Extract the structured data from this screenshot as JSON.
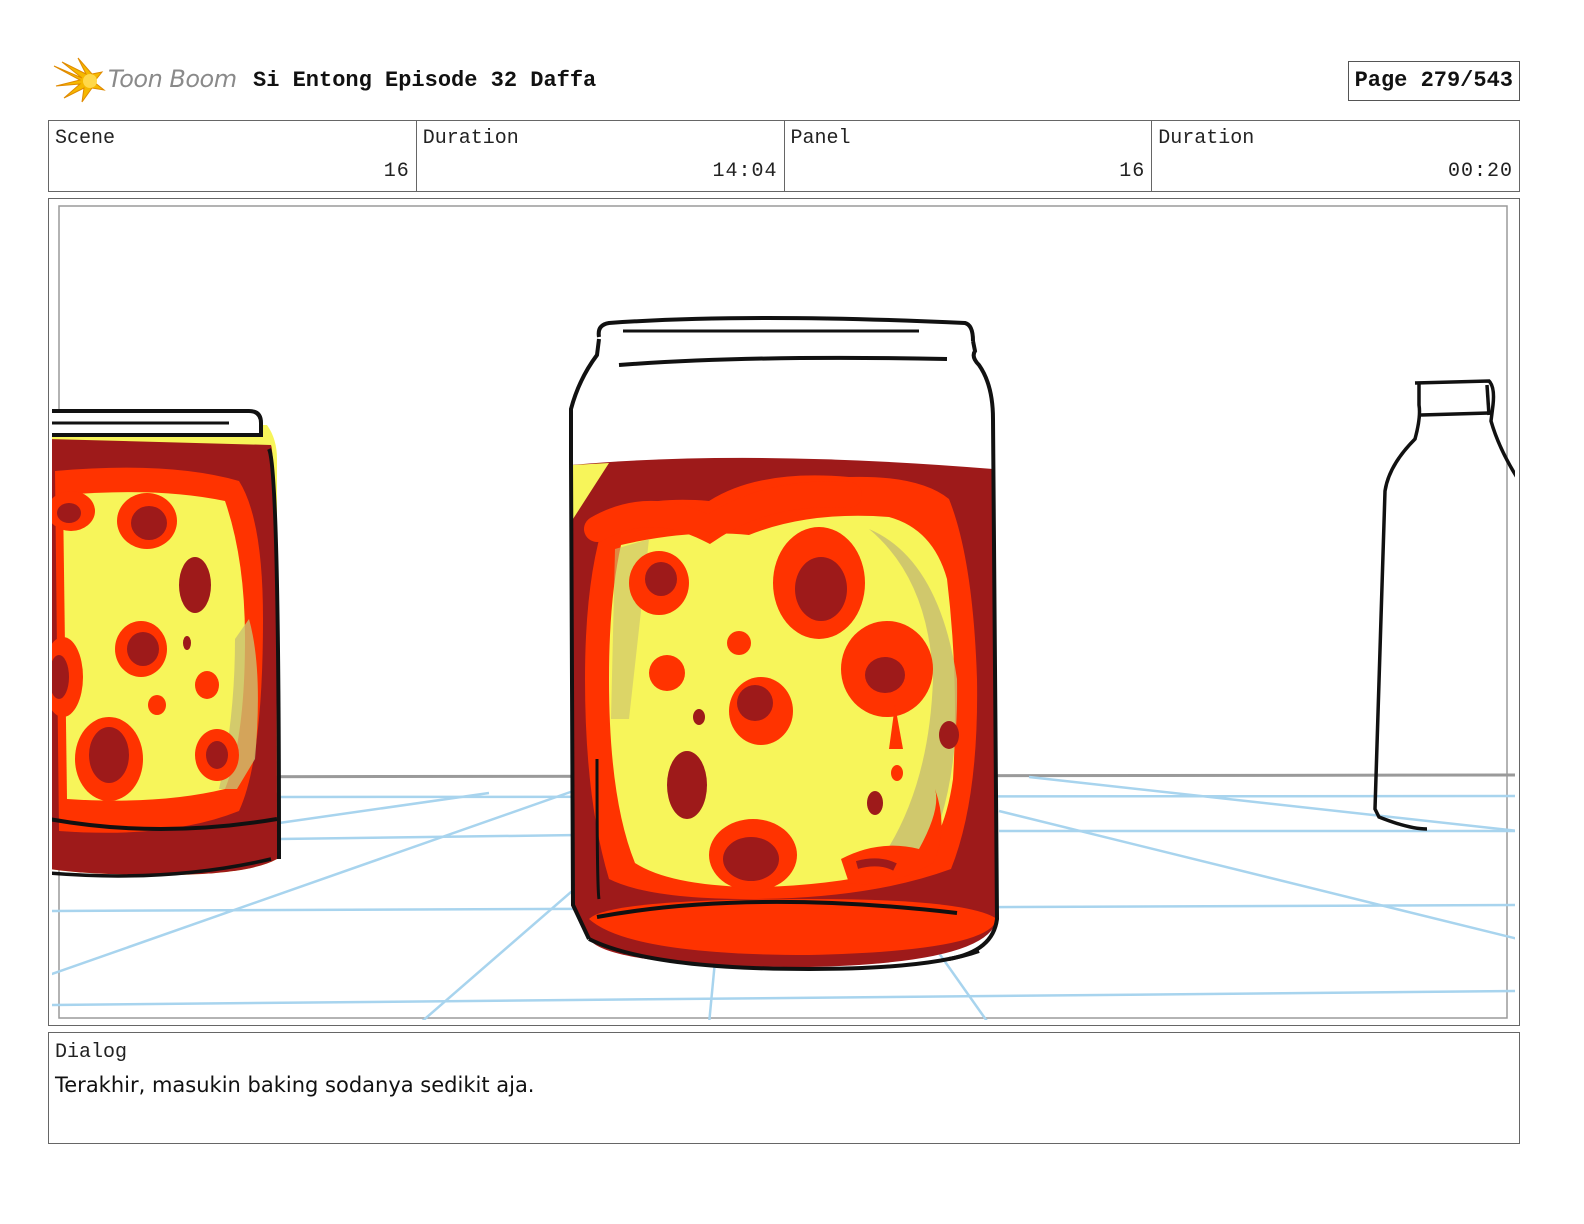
{
  "header": {
    "logo_text": "Toon Boom",
    "project_title": "Si Entong Episode 32 Daffa",
    "page_label": "Page 279/543"
  },
  "info": [
    {
      "label": "Scene",
      "value": "16"
    },
    {
      "label": "Duration",
      "value": "14:04"
    },
    {
      "label": "Panel",
      "value": "16"
    },
    {
      "label": "Duration",
      "value": "00:20"
    }
  ],
  "dialog": {
    "label": "Dialog",
    "text": "Terakhir, masukin baking sodanya sedikit aja."
  },
  "colors": {
    "logo_burst": "#f5b800",
    "jar_outer": "#9e1a1a",
    "jar_ring": "#ff3300",
    "jar_core": "#f7f55a",
    "grid_line": "#a8d4ee"
  }
}
